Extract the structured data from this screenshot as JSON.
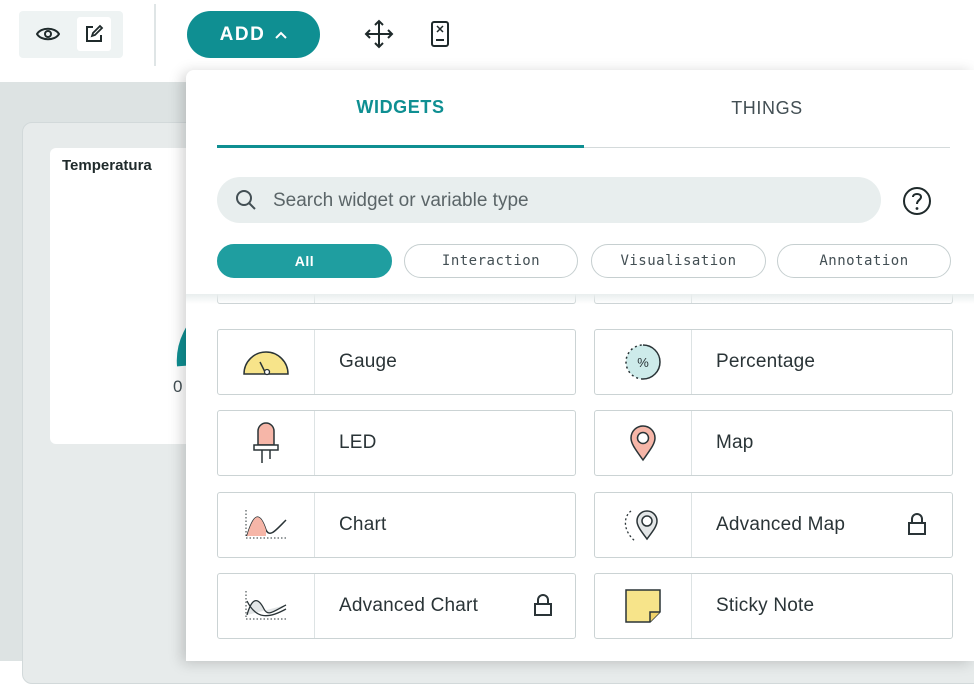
{
  "toolbar": {
    "add_label": "ADD",
    "mode_icons": [
      "eye-icon",
      "edit-icon"
    ],
    "tool_icons": [
      "move-icon",
      "mobile-icon"
    ]
  },
  "dashboard": {
    "widget_title": "Temperatura",
    "gauge_min": "0"
  },
  "panel": {
    "tabs": [
      {
        "label": "WIDGETS",
        "active": true
      },
      {
        "label": "THINGS",
        "active": false
      }
    ],
    "search": {
      "placeholder": "Search widget or variable type",
      "value": ""
    },
    "filters": [
      {
        "label": "All",
        "active": true
      },
      {
        "label": "Interaction",
        "active": false
      },
      {
        "label": "Visualisation",
        "active": false
      },
      {
        "label": "Annotation",
        "active": false
      }
    ],
    "widgets": [
      {
        "label": "Gauge",
        "icon": "gauge-icon",
        "locked": false
      },
      {
        "label": "Percentage",
        "icon": "percentage-icon",
        "locked": false
      },
      {
        "label": "LED",
        "icon": "led-icon",
        "locked": false
      },
      {
        "label": "Map",
        "icon": "map-pin-icon",
        "locked": false
      },
      {
        "label": "Chart",
        "icon": "chart-icon",
        "locked": false
      },
      {
        "label": "Advanced Map",
        "icon": "advanced-map-icon",
        "locked": true
      },
      {
        "label": "Advanced Chart",
        "icon": "advanced-chart-icon",
        "locked": true
      },
      {
        "label": "Sticky Note",
        "icon": "sticky-note-icon",
        "locked": false
      }
    ]
  },
  "colors": {
    "accent": "#0f8f92",
    "chip_active": "#1f9ea0",
    "canvas_bg": "#dde3e3"
  }
}
